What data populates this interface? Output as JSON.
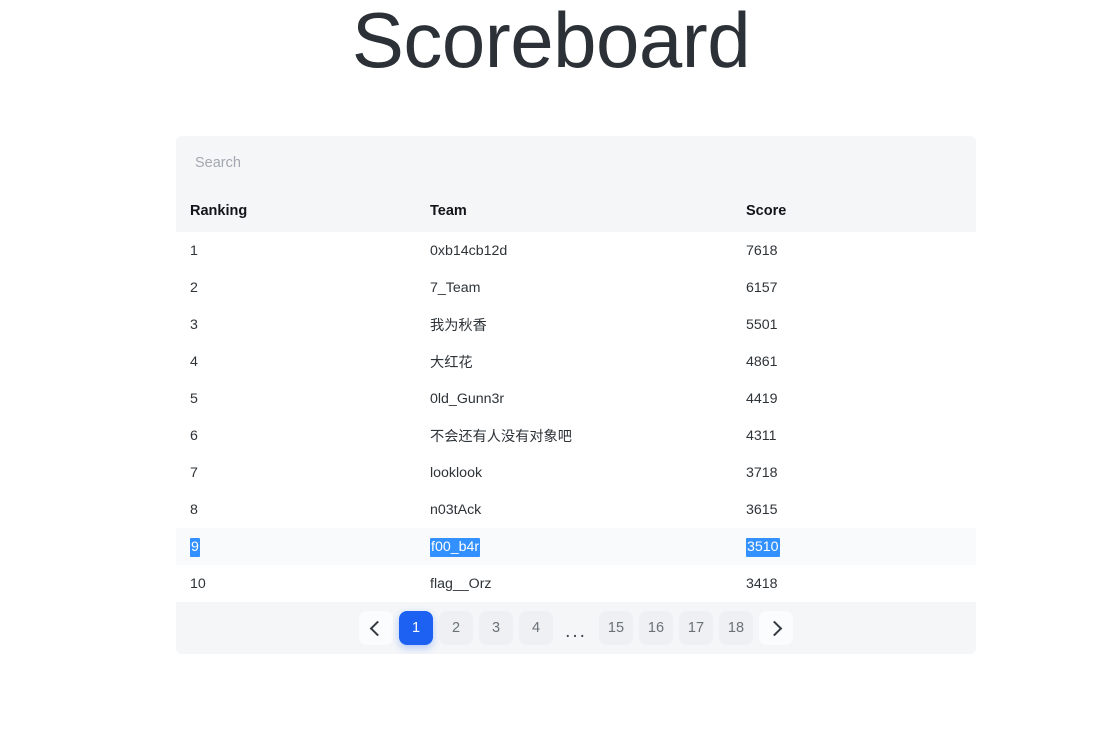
{
  "page": {
    "title": "Scoreboard",
    "background_color": "#ffffff",
    "title_color": "#2b3137"
  },
  "search": {
    "placeholder": "Search",
    "value": ""
  },
  "table": {
    "columns": [
      "Ranking",
      "Team",
      "Score"
    ],
    "rows": [
      {
        "ranking": "1",
        "team": "0xb14cb12d",
        "score": "7618",
        "highlighted": false
      },
      {
        "ranking": "2",
        "team": "7_Team",
        "score": "6157",
        "highlighted": false
      },
      {
        "ranking": "3",
        "team": "我为秋香",
        "score": "5501",
        "highlighted": false
      },
      {
        "ranking": "4",
        "team": "大红花",
        "score": "4861",
        "highlighted": false
      },
      {
        "ranking": "5",
        "team": "0ld_Gunn3r",
        "score": "4419",
        "highlighted": false
      },
      {
        "ranking": "6",
        "team": "不会还有人没有对象吧",
        "score": "4311",
        "highlighted": false
      },
      {
        "ranking": "7",
        "team": "looklook",
        "score": "3718",
        "highlighted": false
      },
      {
        "ranking": "8",
        "team": "n03tAck",
        "score": "3615",
        "highlighted": false
      },
      {
        "ranking": "9",
        "team": "f00_b4r",
        "score": "3510",
        "highlighted": true
      },
      {
        "ranking": "10",
        "team": "flag__Orz",
        "score": "3418",
        "highlighted": false
      }
    ]
  },
  "pagination": {
    "prev_icon": "chevron-left-icon",
    "next_icon": "chevron-right-icon",
    "active_page": "1",
    "ellipsis": "...",
    "pages_left": [
      "1",
      "2",
      "3",
      "4"
    ],
    "pages_right": [
      "15",
      "16",
      "17",
      "18"
    ],
    "accent_color": "#1c61f2",
    "selection_color": "#3390ff"
  }
}
